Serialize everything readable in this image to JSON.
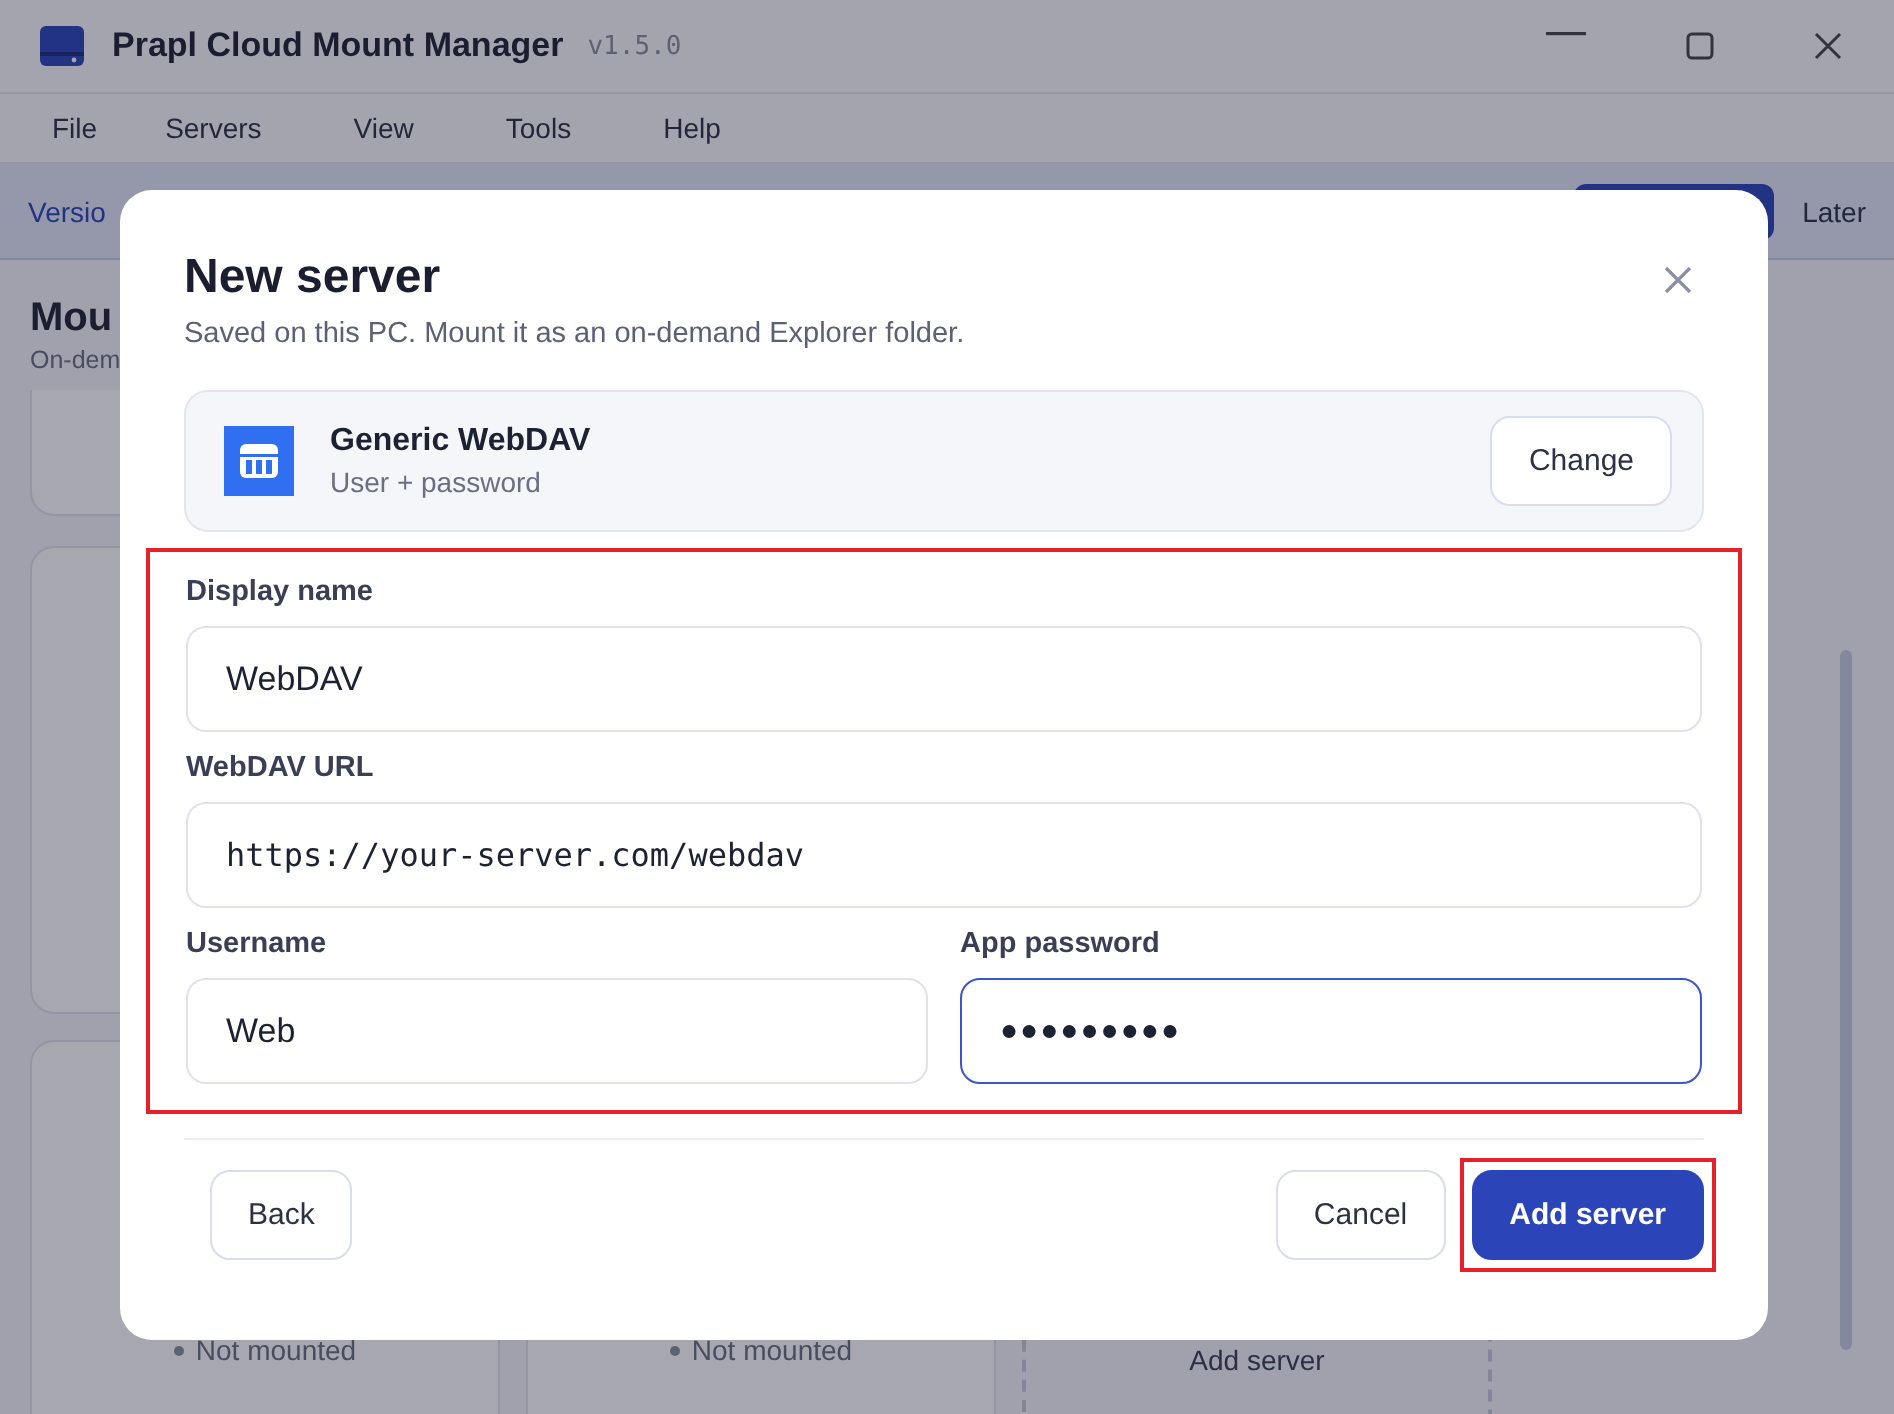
{
  "window": {
    "title": "Prapl Cloud Mount Manager",
    "version": "v1.5.0"
  },
  "menu": [
    "File",
    "Servers",
    "View",
    "Tools",
    "Help"
  ],
  "banner": {
    "text": "Versio",
    "dismiss": "Later"
  },
  "page": {
    "title": "Mou",
    "subtitle": "On-dem"
  },
  "cards": [
    {
      "status": "Not mounted"
    },
    {
      "status": "Not mounted"
    }
  ],
  "add_card": {
    "label": "Add server"
  },
  "dialog": {
    "title": "New server",
    "subtitle": "Saved on this PC. Mount it as an on-demand Explorer folder.",
    "provider": {
      "name": "Generic WebDAV",
      "auth": "User + password",
      "action": "Change"
    },
    "highlighted": true,
    "rows": [
      [
        {
          "label": "Display name",
          "value": "WebDAV",
          "kind": "text",
          "focused": false
        }
      ],
      [
        {
          "label": "WebDAV URL",
          "value": "https://your-server.com/webdav",
          "kind": "mono",
          "focused": false
        }
      ],
      [
        {
          "label": "Username",
          "value": "Web",
          "kind": "text",
          "focused": false
        },
        {
          "label": "App password",
          "value": "●●●●●●●●●",
          "kind": "password",
          "focused": true
        }
      ]
    ],
    "buttons": [
      {
        "label": "Back",
        "kind": "secondary",
        "highlighted": false
      },
      {
        "label": "Cancel",
        "kind": "secondary",
        "highlighted": false
      },
      {
        "label": "Add server",
        "kind": "primary",
        "highlighted": true
      }
    ]
  }
}
